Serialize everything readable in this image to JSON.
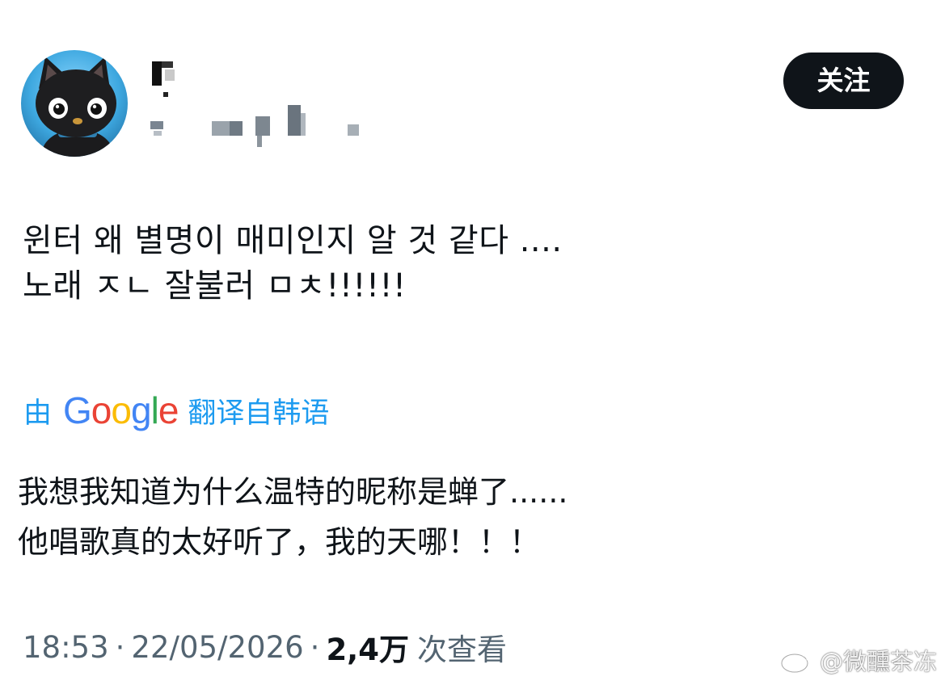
{
  "follow_button": {
    "label": "关注"
  },
  "tweet": {
    "original_lines": [
      "윈터 왜 별명이 매미인지 알 것 같다 ....",
      "노래 ㅈㄴ 잘불러 ㅁㅊ!!!!!!"
    ],
    "translation_attribution": {
      "prefix": "由",
      "brand_letters": [
        {
          "char": "G",
          "color": "#4285f4"
        },
        {
          "char": "o",
          "color": "#ea4335"
        },
        {
          "char": "o",
          "color": "#fbbc05"
        },
        {
          "char": "g",
          "color": "#4285f4"
        },
        {
          "char": "l",
          "color": "#34a853"
        },
        {
          "char": "e",
          "color": "#ea4335"
        }
      ],
      "suffix": "翻译自韩语"
    },
    "translated_lines": [
      "我想我知道为什么温特的昵称是蝉了......",
      "他唱歌真的太好听了，我的天哪！！！"
    ]
  },
  "meta": {
    "time": "18:53",
    "separator": "·",
    "date": "22/05/2026",
    "views_count": "2,4万",
    "views_label": "次查看"
  },
  "watermark": {
    "text": "@微醺茶冻"
  },
  "colors": {
    "accent": "#1d9bf0",
    "text": "#0f1419",
    "secondary_text": "#536471",
    "button_bg": "#0f1419"
  }
}
